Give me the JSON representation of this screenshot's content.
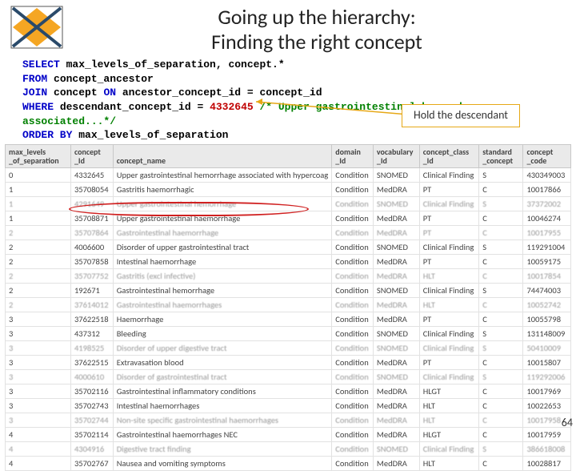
{
  "title_line1": "Going up the hierarchy:",
  "title_line2": "Finding the right concept",
  "sql": {
    "l1a": "SELECT",
    "l1b": " max_levels_of_separation, concept.*",
    "l2a": "FROM",
    "l2b": " concept_ancestor",
    "l3a": "JOIN",
    "l3b": " concept ",
    "l3c": "ON",
    "l3d": " ancestor_concept_id = concept_id",
    "l4a": "WHERE",
    "l4b": " descendant_concept_id = ",
    "l4num": "4332645",
    "l4cmt": " /* Upper gastrointestinal hemorrhage associated...*/",
    "l5a": "ORDER BY",
    "l5b": " max_levels_of_separation"
  },
  "callout": "Hold the descendant",
  "headers": [
    "max_levels _of_separation",
    "concept _Id",
    "concept_name",
    "domain _Id",
    "vocabulary _Id",
    "concept_class _Id",
    "standard _concept",
    "concept _code"
  ],
  "rows": [
    {
      "blur": false,
      "c": [
        "0",
        "4332645",
        "Upper gastrointestinal hemorrhage associated with hypercoag",
        "Condition",
        "SNOMED",
        "Clinical Finding",
        "S",
        "430349003"
      ]
    },
    {
      "blur": false,
      "c": [
        "1",
        "35708054",
        "Gastritis haemorrhagic",
        "Condition",
        "MedDRA",
        "PT",
        "C",
        "10017866"
      ]
    },
    {
      "blur": true,
      "c": [
        "1",
        "4291649",
        "Upper gastrointestinal hemorrhage",
        "Condition",
        "SNOMED",
        "Clinical Finding",
        "S",
        "37372002"
      ]
    },
    {
      "blur": false,
      "c": [
        "1",
        "35708871",
        "Upper gastrointestinal haemorrhage",
        "Condition",
        "MedDRA",
        "PT",
        "C",
        "10046274"
      ]
    },
    {
      "blur": true,
      "c": [
        "2",
        "35707864",
        "Gastrointestinal haemorrhage",
        "Condition",
        "MedDRA",
        "PT",
        "C",
        "10017955"
      ]
    },
    {
      "blur": false,
      "c": [
        "2",
        "4006600",
        "Disorder of upper gastrointestinal tract",
        "Condition",
        "SNOMED",
        "Clinical Finding",
        "S",
        "119291004"
      ]
    },
    {
      "blur": false,
      "c": [
        "2",
        "35707858",
        "Intestinal haemorrhage",
        "Condition",
        "MedDRA",
        "PT",
        "C",
        "10059175"
      ]
    },
    {
      "blur": true,
      "c": [
        "2",
        "35707752",
        "Gastritis (excl infective)",
        "Condition",
        "MedDRA",
        "HLT",
        "C",
        "10017854"
      ]
    },
    {
      "blur": false,
      "c": [
        "2",
        "192671",
        "Gastrointestinal hemorrhage",
        "Condition",
        "SNOMED",
        "Clinical Finding",
        "S",
        "74474003"
      ]
    },
    {
      "blur": true,
      "c": [
        "2",
        "37614012",
        "Gastrointestinal haemorrhages",
        "Condition",
        "MedDRA",
        "HLT",
        "C",
        "10052742"
      ]
    },
    {
      "blur": false,
      "c": [
        "3",
        "37622518",
        "Haemorrhage",
        "Condition",
        "MedDRA",
        "PT",
        "C",
        "10055798"
      ]
    },
    {
      "blur": false,
      "c": [
        "3",
        "437312",
        "Bleeding",
        "Condition",
        "SNOMED",
        "Clinical Finding",
        "S",
        "131148009"
      ]
    },
    {
      "blur": true,
      "c": [
        "3",
        "4198525",
        "Disorder of upper digestive tract",
        "Condition",
        "SNOMED",
        "Clinical Finding",
        "S",
        "50410009"
      ]
    },
    {
      "blur": false,
      "c": [
        "3",
        "37622515",
        "Extravasation blood",
        "Condition",
        "MedDRA",
        "PT",
        "C",
        "10015807"
      ]
    },
    {
      "blur": true,
      "c": [
        "3",
        "4000610",
        "Disorder of gastrointestinal tract",
        "Condition",
        "SNOMED",
        "Clinical Finding",
        "S",
        "119292006"
      ]
    },
    {
      "blur": false,
      "c": [
        "3",
        "35702116",
        "Gastrointestinal inflammatory conditions",
        "Condition",
        "MedDRA",
        "HLGT",
        "C",
        "10017969"
      ]
    },
    {
      "blur": false,
      "c": [
        "3",
        "35702743",
        "Intestinal haemorrhages",
        "Condition",
        "MedDRA",
        "HLT",
        "C",
        "10022653"
      ]
    },
    {
      "blur": true,
      "c": [
        "3",
        "35702744",
        "Non-site specific gastrointestinal haemorrhages",
        "Condition",
        "MedDRA",
        "HLT",
        "C",
        "10017958"
      ]
    },
    {
      "blur": false,
      "c": [
        "4",
        "35702114",
        "Gastrointestinal haemorrhages NEC",
        "Condition",
        "MedDRA",
        "HLGT",
        "C",
        "10017959"
      ]
    },
    {
      "blur": true,
      "c": [
        "4",
        "4304916",
        "Digestive tract finding",
        "Condition",
        "SNOMED",
        "Clinical Finding",
        "S",
        "386618008"
      ]
    },
    {
      "blur": false,
      "c": [
        "4",
        "35702767",
        "Nausea and vomiting symptoms",
        "Condition",
        "MedDRA",
        "HLT",
        "C",
        "10028817"
      ]
    }
  ],
  "page_number": "64"
}
